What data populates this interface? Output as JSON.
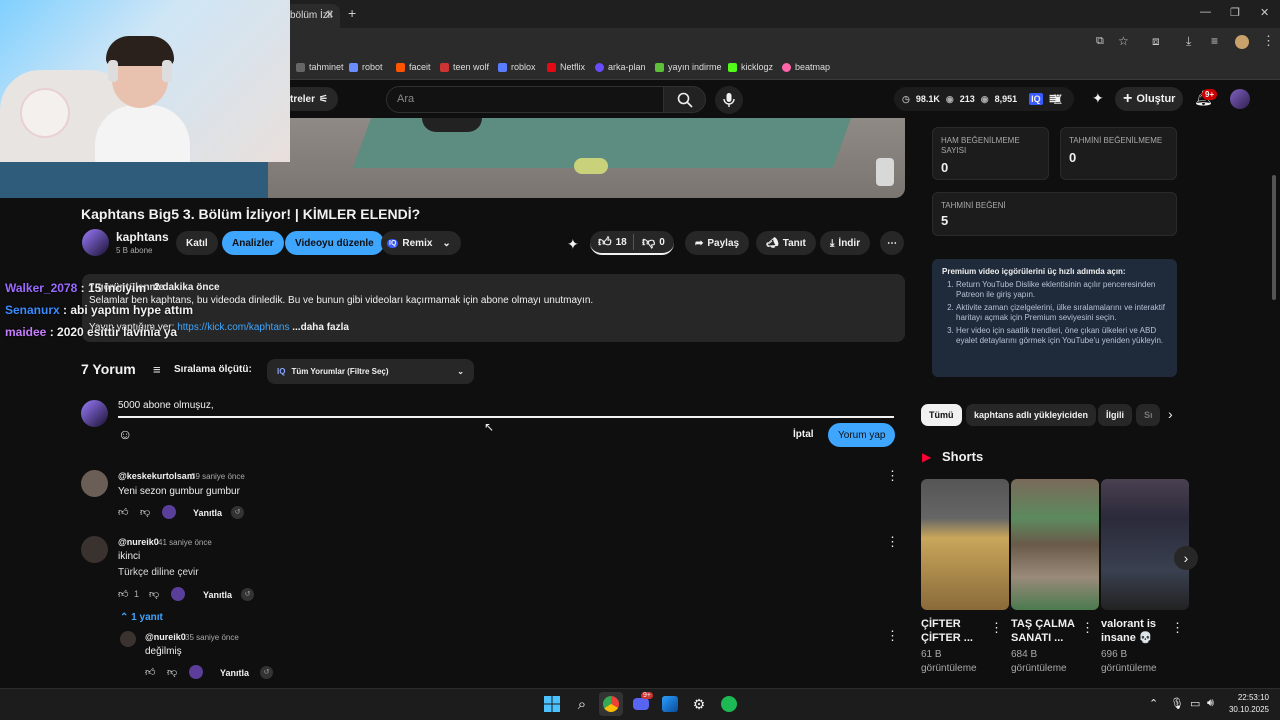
{
  "browser": {
    "tab_title": "bölüm İzli",
    "new_tab": "+",
    "bookmarks": [
      "tahminet",
      "robot",
      "faceit",
      "teen wolf",
      "roblox",
      "Netflix",
      "arka-plan",
      "yayın indirme",
      "kicklogz",
      "beatmap"
    ]
  },
  "header": {
    "filter_label": "treler",
    "search_placeholder": "Ara",
    "ryd": {
      "dislikes_est": "98.1K",
      "views_a": "213",
      "views_b": "8,951"
    },
    "create_label": "Oluştur",
    "notif_badge": "9+"
  },
  "stream_chat": [
    {
      "user": "Walker_2078",
      "sep": " : ",
      "msg": "15 inciyim",
      "color": "#9b6bff"
    },
    {
      "user": "Senanurx",
      "sep": " : ",
      "msg": "abi yaptım hype attım",
      "color": "#3b8bff"
    },
    {
      "user": "maidee",
      "sep": " : ",
      "msg": "2020 esittir lavinia ya",
      "color": "#c77dff"
    }
  ],
  "video": {
    "title": "Kaphtans Big5 3. Bölüm İzliyor! | KİMLER ELENDİ?",
    "channel": "kaphtans",
    "subs": "5 B abone",
    "join_label": "Katıl",
    "analytics_label": "Analizler",
    "edit_label": "Videoyu düzenle",
    "remix_label": "Remix",
    "likes": "18",
    "dislikes": "0",
    "share_label": "Paylaş",
    "promote_label": "Tanıt",
    "download_label": "İndir"
  },
  "description": {
    "meta_prefix": "7 görüntülenme",
    "meta": "2 dakika önce",
    "line1": "Selamlar ben kaphtans, bu videoda dinledik. Bu ve bunun gibi videoları kaçırmamak için abone olmayı unutmayın.",
    "line2_prefix": "Yayın yaptığım yer: ",
    "line2_link": "https://kick.com/kaphtans",
    "more": "...daha fazla"
  },
  "comments": {
    "count_label": "7 Yorum",
    "sort_label": "Sıralama ölçütü:",
    "filter_label": "Tüm Yorumlar (Filtre Seç)",
    "draft": "5000 abone olmuşuz, ",
    "cancel_label": "İptal",
    "submit_label": "Yorum yap",
    "items": [
      {
        "user": "@keskekurtolsam",
        "time": "39 saniye önce",
        "text": "Yeni sezon gumbur gumbur",
        "likes": "",
        "reply": "Yanıtla"
      },
      {
        "user": "@nureik0",
        "time": "41 saniye önce",
        "text": "ikinci",
        "text2": "Türkçe diline çevir",
        "likes": "1",
        "reply": "Yanıtla"
      }
    ],
    "replies_toggle": "1 yanıt",
    "reply": {
      "user": "@nureik0",
      "time": "35 saniye önce",
      "text": "değilmiş",
      "reply": "Yanıtla"
    }
  },
  "sidebar": {
    "stats": [
      {
        "label": "HAM BEĞENİLMEME SAYISI",
        "value": "0"
      },
      {
        "label": "TAHMİNİ BEĞENİLMEME",
        "value": "0"
      },
      {
        "label": "TAHMİNİ BEĞENİ",
        "value": "5"
      }
    ],
    "premium_title": "Premium video içgörülerini üç hızlı adımda açın:",
    "premium_steps": [
      "Return YouTube Dislike eklentisinin açılır penceresinden Patreon ile giriş yapın.",
      "Aktivite zaman çizelgelerini, ülke sıralamalarını ve interaktif haritayı açmak için Premium seviyesini seçin.",
      "Her video için saatlik trendleri, öne çıkan ülkeleri ve ABD eyalet detaylarını görmek için YouTube'u yeniden yükleyin."
    ],
    "chips": [
      "Tümü",
      "kaphtans adlı yükleyiciden",
      "İlgili",
      "Sı"
    ],
    "shorts_label": "Shorts",
    "shorts": [
      {
        "title": "ÇİFTER ÇİFTER ...",
        "views": "61 B görüntüleme"
      },
      {
        "title": "TAŞ ÇALMA SANATI ...",
        "views": "684 B görüntüleme"
      },
      {
        "title": "valorant is insane 💀",
        "views": "696 B görüntüleme"
      }
    ]
  },
  "taskbar": {
    "time": "22:53:10",
    "date": "30.10.2025",
    "discord_badge": "9+"
  },
  "colors": {
    "accent": "#3ea6ff",
    "background": "#0f0f0f",
    "surface": "#272727"
  }
}
